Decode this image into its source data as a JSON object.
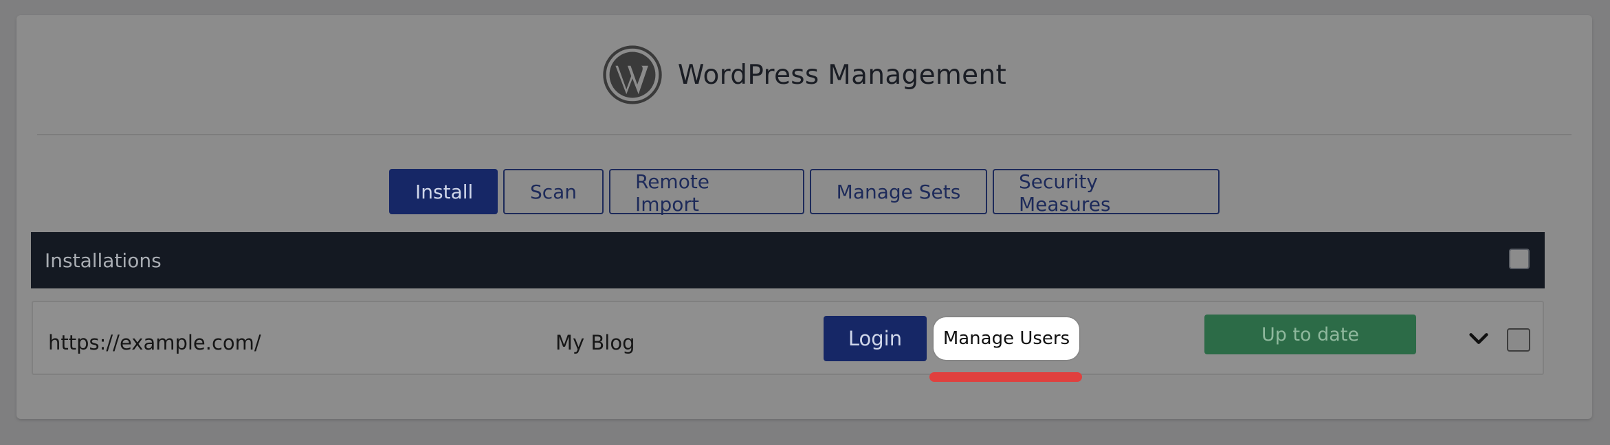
{
  "header": {
    "title": "WordPress Management",
    "logo_icon": "wordpress-logo-icon"
  },
  "tabs": [
    {
      "label": "Install",
      "active": true
    },
    {
      "label": "Scan",
      "active": false
    },
    {
      "label": "Remote Import",
      "active": false
    },
    {
      "label": "Manage Sets",
      "active": false
    },
    {
      "label": "Security Measures",
      "active": false
    }
  ],
  "table": {
    "header_label": "Installations",
    "rows": [
      {
        "url": "https://example.com/",
        "site_name": "My Blog",
        "login_label": "Login",
        "manage_users_label": "Manage Users",
        "status_label": "Up to date"
      }
    ]
  },
  "colors": {
    "primary": "#162766",
    "status_green": "#2c6b47",
    "header_dark": "#141922",
    "highlight": "#e0403e"
  }
}
